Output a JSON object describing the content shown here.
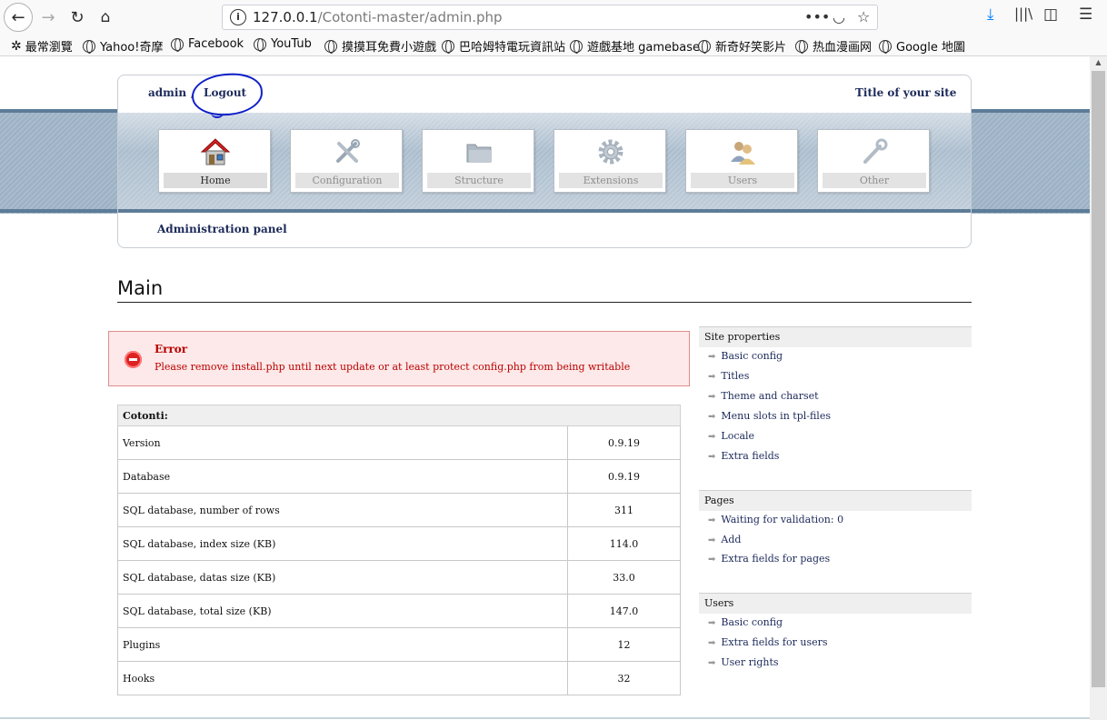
{
  "browser": {
    "url_host": "127.0.0.1",
    "url_path": "/Cotonti-master/admin.php",
    "bookmarks": [
      {
        "label": "最常瀏覽",
        "icon": "gear-icon"
      },
      {
        "label": "Yahoo!奇摩",
        "icon": "globe-icon"
      },
      {
        "label": "Facebook",
        "icon": "globe-icon"
      },
      {
        "label": "YouTub",
        "icon": "globe-icon"
      },
      {
        "label": "摸摸耳免費小遊戲",
        "icon": "globe-icon"
      },
      {
        "label": "巴哈姆特電玩資訊站",
        "icon": "globe-icon"
      },
      {
        "label": "遊戲基地 gamebase",
        "icon": "globe-icon"
      },
      {
        "label": "新奇好笑影片",
        "icon": "globe-icon"
      },
      {
        "label": "热血漫画网",
        "icon": "globe-icon"
      },
      {
        "label": "Google 地圖",
        "icon": "globe-icon"
      }
    ]
  },
  "header": {
    "user": "admin",
    "separator": "/",
    "logout": "Logout",
    "site_title": "Title of your site",
    "breadcrumb": "Administration panel",
    "annotation_color": "#1020c8"
  },
  "nav": [
    {
      "label": "Home",
      "icon": "home-icon",
      "active": true
    },
    {
      "label": "Configuration",
      "icon": "tools-icon",
      "active": false
    },
    {
      "label": "Structure",
      "icon": "folder-icon",
      "active": false
    },
    {
      "label": "Extensions",
      "icon": "gear-icon",
      "active": false
    },
    {
      "label": "Users",
      "icon": "users-icon",
      "active": false
    },
    {
      "label": "Other",
      "icon": "wrench-icon",
      "active": false
    }
  ],
  "main": {
    "title": "Main",
    "error": {
      "title": "Error",
      "message": "Please remove install.php until next update or at least protect config.php from being writable"
    },
    "info_table": {
      "header": "Cotonti:",
      "rows": [
        {
          "label": "Version",
          "value": "0.9.19"
        },
        {
          "label": "Database",
          "value": "0.9.19"
        },
        {
          "label": "SQL database, number of rows",
          "value": "311"
        },
        {
          "label": "SQL database, index size (KB)",
          "value": "114.0"
        },
        {
          "label": "SQL database, datas size (KB)",
          "value": "33.0"
        },
        {
          "label": "SQL database, total size (KB)",
          "value": "147.0"
        },
        {
          "label": "Plugins",
          "value": "12"
        },
        {
          "label": "Hooks",
          "value": "32"
        }
      ]
    }
  },
  "side": {
    "site_properties": {
      "title": "Site properties",
      "links": [
        "Basic config",
        "Titles",
        "Theme and charset",
        "Menu slots in tpl-files",
        "Locale",
        "Extra fields"
      ]
    },
    "pages": {
      "title": "Pages",
      "links": [
        "Waiting for validation: 0",
        "Add",
        "Extra fields for pages"
      ]
    },
    "users": {
      "title": "Users",
      "links": [
        "Basic config",
        "Extra fields for users",
        "User rights"
      ]
    }
  }
}
